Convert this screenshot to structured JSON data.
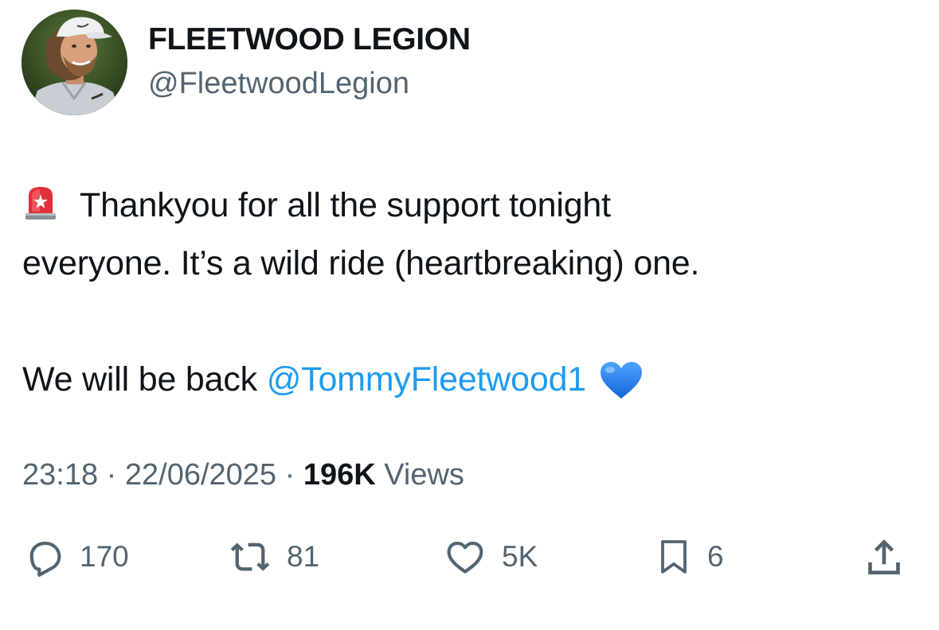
{
  "author": {
    "display_name": "FLEETWOOD LEGION",
    "handle": "@FleetwoodLegion"
  },
  "tweet": {
    "line1": "Thankyou for all the support tonight",
    "line2": "everyone. It’s a wild ride (heartbreaking) one.",
    "line3_text": "We will be back ",
    "mention": "@TommyFleetwood1",
    "leading_emoji": "police-car-light-emoji",
    "trailing_emoji": "blue-heart-emoji"
  },
  "meta": {
    "time": "23:18",
    "separator": " · ",
    "date": "22/06/2025",
    "views_count": "196K",
    "views_label": " Views"
  },
  "actions": {
    "reply_count": "170",
    "repost_count": "81",
    "like_count": "5K",
    "bookmark_count": "6"
  },
  "colors": {
    "text": "#0f1419",
    "secondary": "#536471",
    "link": "#1d9bf0",
    "heart_emoji": "#1e7fe6",
    "siren_emoji": "#e0303a"
  }
}
